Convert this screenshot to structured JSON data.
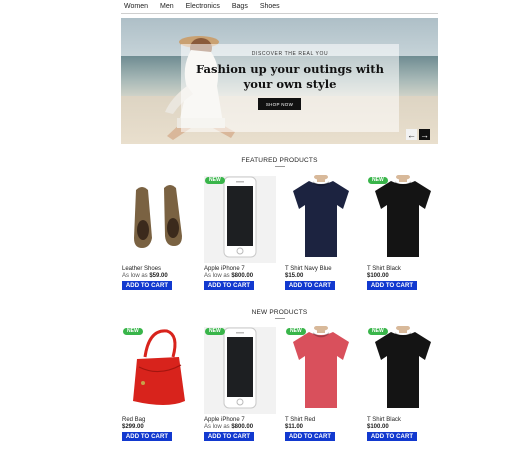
{
  "nav": {
    "items": [
      "Women",
      "Men",
      "Electronics",
      "Bags",
      "Shoes"
    ]
  },
  "hero": {
    "eyebrow": "DISCOVER THE REAL YOU",
    "headline_line1": "Fashion up your outings with",
    "headline_line2": "your own style",
    "cta": "SHOP NOW",
    "prev_arrow": "←",
    "next_arrow": "→"
  },
  "featured": {
    "title": "FEATURED PRODUCTS",
    "products": [
      {
        "name": "Leather Shoes",
        "prefix": "As low as ",
        "price": "$59.00",
        "badge": "",
        "image": "shoes",
        "cart": "ADD TO CART"
      },
      {
        "name": "Apple iPhone 7",
        "prefix": "As low as ",
        "price": "$800.00",
        "badge": "NEW",
        "image": "phone",
        "cart": "ADD TO CART"
      },
      {
        "name": "T Shirt Navy Blue",
        "prefix": "",
        "price": "$15.00",
        "badge": "",
        "image": "tshirt-navy",
        "cart": "ADD TO CART"
      },
      {
        "name": "T Shirt Black",
        "prefix": "",
        "price": "$100.00",
        "badge": "NEW",
        "image": "tshirt-black",
        "cart": "ADD TO CART"
      }
    ]
  },
  "new": {
    "title": "NEW PRODUCTS",
    "products": [
      {
        "name": "Red Bag",
        "prefix": "",
        "price": "$299.00",
        "badge": "NEW",
        "image": "red-bag",
        "cart": "ADD TO CART"
      },
      {
        "name": "Apple iPhone 7",
        "prefix": "As low as ",
        "price": "$800.00",
        "badge": "NEW",
        "image": "phone",
        "cart": "ADD TO CART"
      },
      {
        "name": "T Shirt Red",
        "prefix": "",
        "price": "$11.00",
        "badge": "NEW",
        "image": "tshirt-red",
        "cart": "ADD TO CART"
      },
      {
        "name": "T Shirt Black",
        "prefix": "",
        "price": "$100.00",
        "badge": "NEW",
        "image": "tshirt-black",
        "cart": "ADD TO CART"
      }
    ]
  },
  "colors": {
    "cart_button": "#1239cf",
    "badge": "#39b54a",
    "navy": "#1c2340",
    "black": "#141414",
    "red_shirt": "#d9505c",
    "red_bag": "#d8231c",
    "shoe": "#7a6242"
  }
}
